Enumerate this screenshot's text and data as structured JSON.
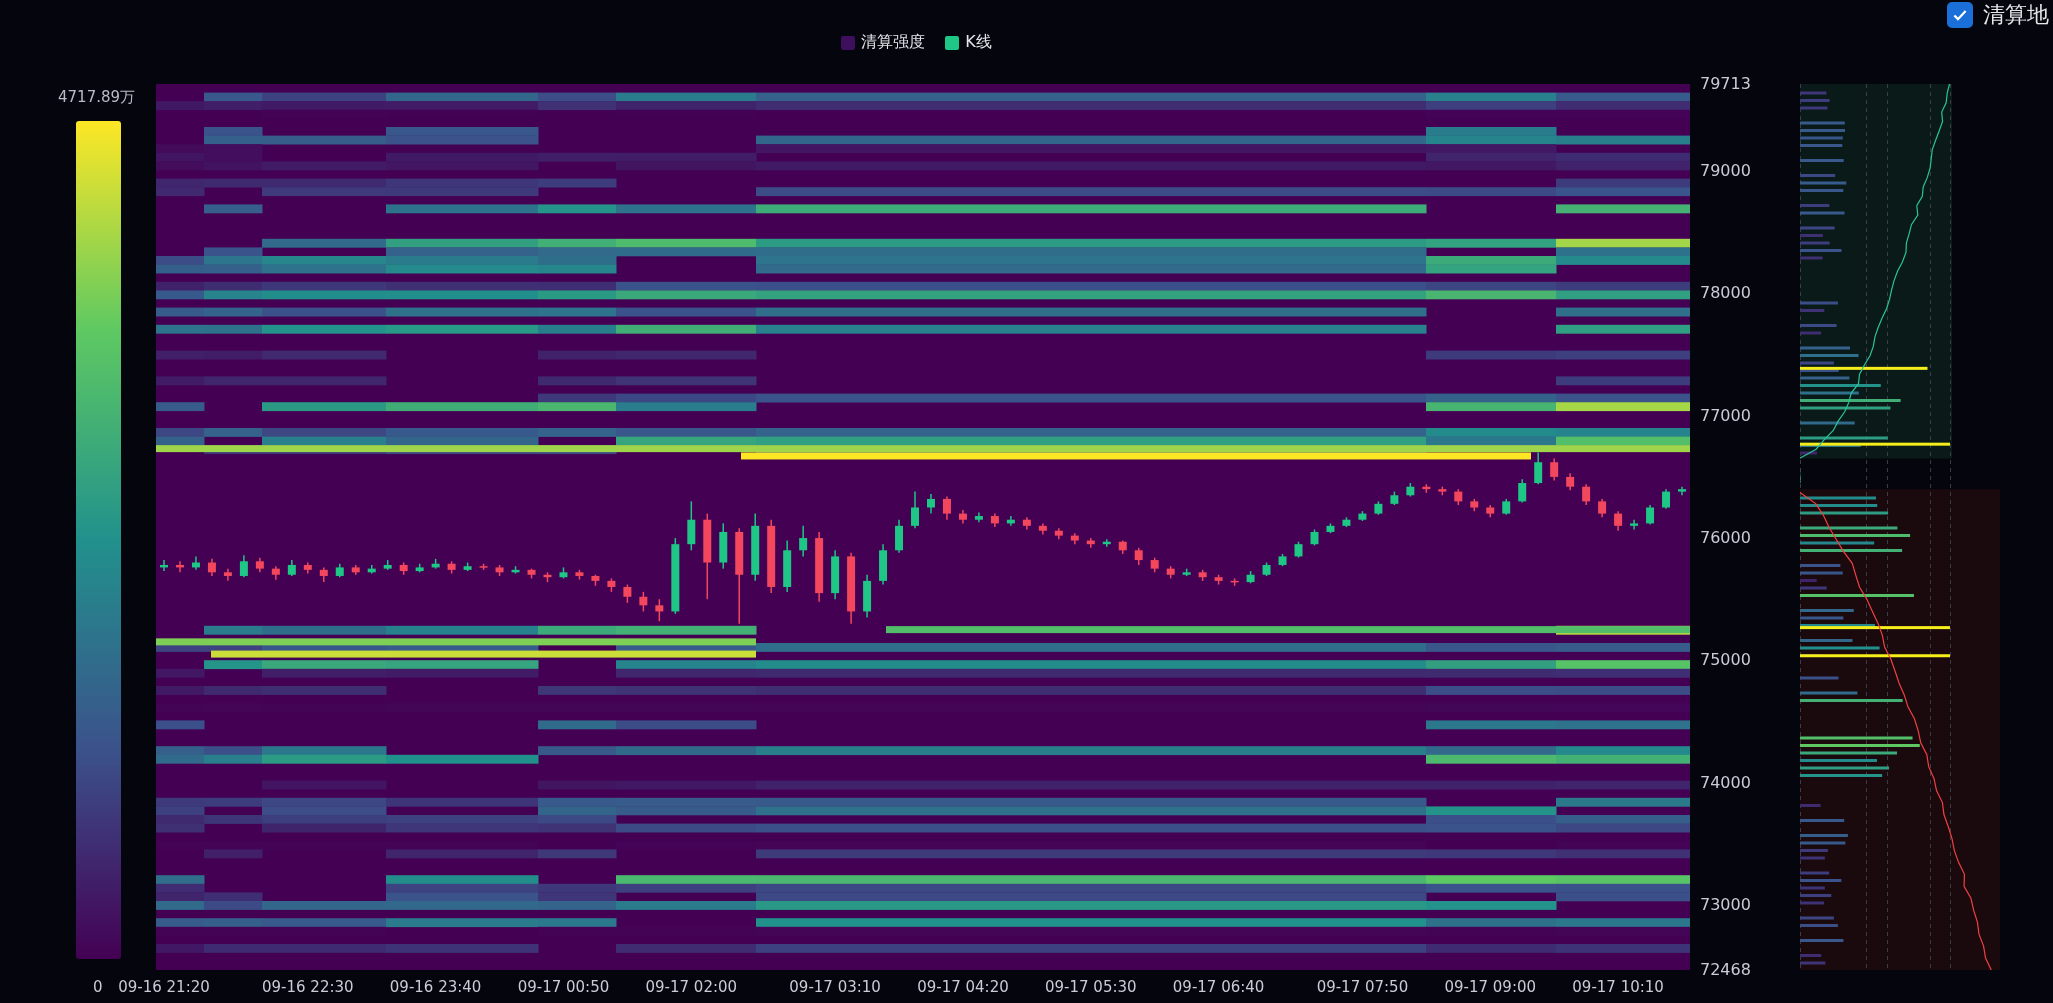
{
  "legend": [
    {
      "label": "清算强度",
      "color": "#3d0f5c"
    },
    {
      "label": "K线",
      "color": "#1ec785"
    }
  ],
  "toggle": {
    "label": "清算地",
    "checked": true
  },
  "color_scale": {
    "max_label": "4717.89万",
    "min_label": "0"
  },
  "chart_data": {
    "type": "candlestick",
    "ylim": [
      72468,
      79713
    ],
    "yticks": [
      79713,
      79000,
      78000,
      77000,
      76000,
      75000,
      74000,
      73000,
      72468
    ],
    "categories": [
      "09-16 21:20",
      null,
      null,
      null,
      null,
      null,
      null,
      null,
      null,
      "09-16 22:30",
      null,
      null,
      null,
      null,
      null,
      null,
      null,
      "09-16 23:40",
      null,
      null,
      null,
      null,
      null,
      null,
      null,
      "09-17 00:50",
      null,
      null,
      null,
      null,
      null,
      null,
      null,
      "09-17 02:00",
      null,
      null,
      null,
      null,
      null,
      null,
      null,
      null,
      "09-17 03:10",
      null,
      null,
      null,
      null,
      null,
      null,
      null,
      "09-17 04:20",
      null,
      null,
      null,
      null,
      null,
      null,
      null,
      "09-17 05:30",
      null,
      null,
      null,
      null,
      null,
      null,
      null,
      "09-17 06:40",
      null,
      null,
      null,
      null,
      null,
      null,
      null,
      null,
      "09-17 07:50",
      null,
      null,
      null,
      null,
      null,
      null,
      null,
      "09-17 09:00",
      null,
      null,
      null,
      null,
      null,
      null,
      null,
      "09-17 10:10",
      null,
      null,
      null,
      null
    ],
    "ohlc": [
      [
        75760,
        75820,
        75730,
        75780
      ],
      [
        75780,
        75810,
        75720,
        75760
      ],
      [
        75760,
        75850,
        75740,
        75800
      ],
      [
        75800,
        75830,
        75690,
        75720
      ],
      [
        75720,
        75750,
        75650,
        75690
      ],
      [
        75690,
        75860,
        75680,
        75810
      ],
      [
        75810,
        75840,
        75720,
        75750
      ],
      [
        75750,
        75770,
        75660,
        75700
      ],
      [
        75700,
        75820,
        75690,
        75780
      ],
      [
        75780,
        75800,
        75710,
        75740
      ],
      [
        75740,
        75760,
        75640,
        75690
      ],
      [
        75690,
        75790,
        75680,
        75760
      ],
      [
        75760,
        75780,
        75700,
        75720
      ],
      [
        75720,
        75780,
        75710,
        75750
      ],
      [
        75750,
        75820,
        75740,
        75780
      ],
      [
        75780,
        75800,
        75700,
        75730
      ],
      [
        75730,
        75790,
        75720,
        75760
      ],
      [
        75760,
        75830,
        75750,
        75790
      ],
      [
        75790,
        75810,
        75710,
        75740
      ],
      [
        75740,
        75800,
        75730,
        75770
      ],
      [
        75770,
        75790,
        75740,
        75760
      ],
      [
        75760,
        75780,
        75690,
        75720
      ],
      [
        75720,
        75770,
        75710,
        75740
      ],
      [
        75740,
        75750,
        75670,
        75700
      ],
      [
        75700,
        75720,
        75640,
        75680
      ],
      [
        75680,
        75760,
        75670,
        75720
      ],
      [
        75720,
        75740,
        75660,
        75690
      ],
      [
        75690,
        75700,
        75610,
        75650
      ],
      [
        75650,
        75670,
        75560,
        75600
      ],
      [
        75600,
        75620,
        75470,
        75520
      ],
      [
        75520,
        75560,
        75400,
        75450
      ],
      [
        75450,
        75500,
        75320,
        75400
      ],
      [
        75400,
        76000,
        75380,
        75950
      ],
      [
        75950,
        76300,
        75900,
        76150
      ],
      [
        76150,
        76200,
        75500,
        75800
      ],
      [
        75800,
        76120,
        75750,
        76050
      ],
      [
        76050,
        76080,
        75300,
        75700
      ],
      [
        75700,
        76200,
        75650,
        76100
      ],
      [
        76100,
        76150,
        75550,
        75600
      ],
      [
        75600,
        75980,
        75560,
        75900
      ],
      [
        75900,
        76100,
        75850,
        76000
      ],
      [
        76000,
        76050,
        75480,
        75550
      ],
      [
        75550,
        75900,
        75500,
        75850
      ],
      [
        75850,
        75880,
        75300,
        75400
      ],
      [
        75400,
        75700,
        75350,
        75650
      ],
      [
        75650,
        75950,
        75620,
        75900
      ],
      [
        75900,
        76150,
        75880,
        76100
      ],
      [
        76100,
        76380,
        76080,
        76250
      ],
      [
        76250,
        76360,
        76200,
        76320
      ],
      [
        76320,
        76340,
        76150,
        76200
      ],
      [
        76200,
        76230,
        76120,
        76150
      ],
      [
        76150,
        76210,
        76130,
        76180
      ],
      [
        76180,
        76200,
        76090,
        76120
      ],
      [
        76120,
        76180,
        76100,
        76150
      ],
      [
        76150,
        76170,
        76070,
        76100
      ],
      [
        76100,
        76120,
        76030,
        76060
      ],
      [
        76060,
        76080,
        75990,
        76020
      ],
      [
        76020,
        76040,
        75950,
        75980
      ],
      [
        75980,
        76000,
        75920,
        75950
      ],
      [
        75950,
        75990,
        75930,
        75970
      ],
      [
        75970,
        75980,
        75870,
        75900
      ],
      [
        75900,
        75920,
        75780,
        75820
      ],
      [
        75820,
        75840,
        75720,
        75750
      ],
      [
        75750,
        75770,
        75670,
        75700
      ],
      [
        75700,
        75750,
        75690,
        75720
      ],
      [
        75720,
        75740,
        75650,
        75680
      ],
      [
        75680,
        75700,
        75620,
        75650
      ],
      [
        75650,
        75670,
        75610,
        75640
      ],
      [
        75640,
        75730,
        75630,
        75700
      ],
      [
        75700,
        75800,
        75690,
        75780
      ],
      [
        75780,
        75870,
        75770,
        75850
      ],
      [
        75850,
        75970,
        75840,
        75950
      ],
      [
        75950,
        76070,
        75940,
        76050
      ],
      [
        76050,
        76120,
        76040,
        76100
      ],
      [
        76100,
        76170,
        76090,
        76150
      ],
      [
        76150,
        76220,
        76140,
        76200
      ],
      [
        76200,
        76300,
        76190,
        76280
      ],
      [
        76280,
        76380,
        76270,
        76350
      ],
      [
        76350,
        76450,
        76340,
        76420
      ],
      [
        76420,
        76440,
        76370,
        76400
      ],
      [
        76400,
        76420,
        76350,
        76380
      ],
      [
        76380,
        76400,
        76270,
        76300
      ],
      [
        76300,
        76320,
        76220,
        76250
      ],
      [
        76250,
        76270,
        76170,
        76200
      ],
      [
        76200,
        76320,
        76190,
        76300
      ],
      [
        76300,
        76480,
        76290,
        76450
      ],
      [
        76450,
        76700,
        76440,
        76620
      ],
      [
        76620,
        76650,
        76470,
        76500
      ],
      [
        76500,
        76530,
        76390,
        76420
      ],
      [
        76420,
        76440,
        76270,
        76300
      ],
      [
        76300,
        76320,
        76170,
        76200
      ],
      [
        76200,
        76220,
        76060,
        76100
      ],
      [
        76100,
        76150,
        76070,
        76120
      ],
      [
        76120,
        76270,
        76110,
        76250
      ],
      [
        76250,
        76400,
        76240,
        76380
      ],
      [
        76380,
        76420,
        76350,
        76400
      ]
    ]
  }
}
